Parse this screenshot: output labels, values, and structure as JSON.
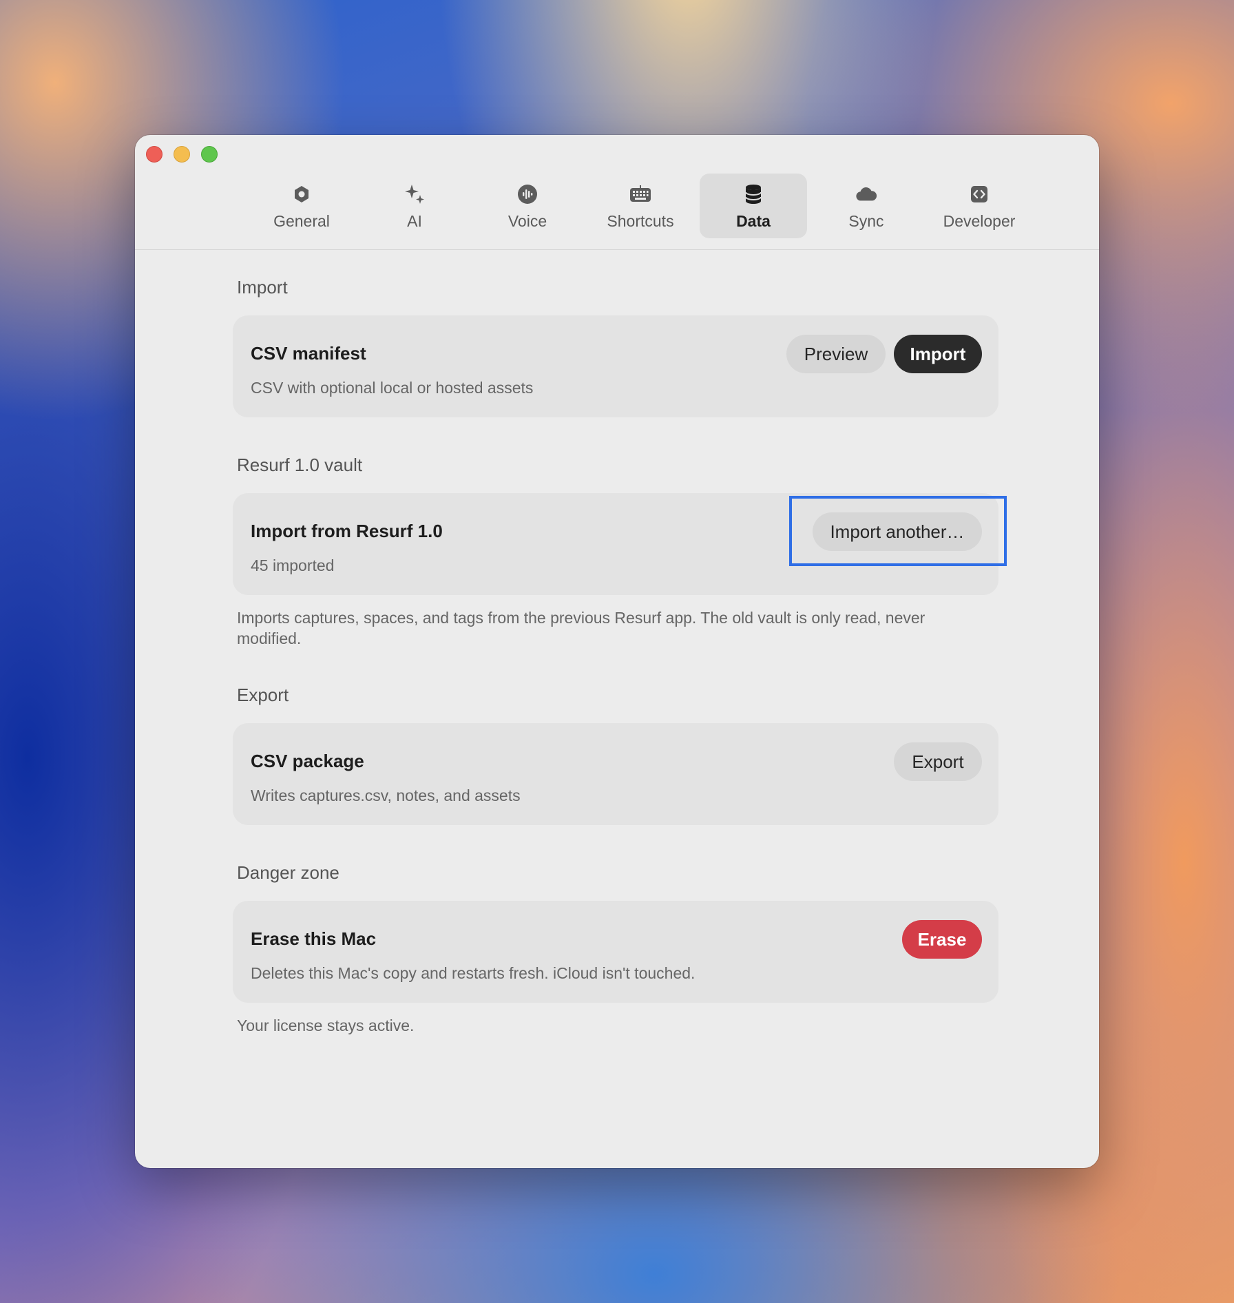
{
  "window": {
    "traffic_lights": [
      "close",
      "minimize",
      "zoom"
    ]
  },
  "tabs": [
    {
      "label": "General",
      "icon": "gear-hexagon-icon"
    },
    {
      "label": "AI",
      "icon": "sparkles-icon"
    },
    {
      "label": "Voice",
      "icon": "waveform-icon"
    },
    {
      "label": "Shortcuts",
      "icon": "keyboard-icon"
    },
    {
      "label": "Data",
      "icon": "database-icon",
      "active": true
    },
    {
      "label": "Sync",
      "icon": "cloud-icon"
    },
    {
      "label": "Developer",
      "icon": "code-icon"
    }
  ],
  "sections": {
    "import": {
      "title": "Import",
      "card_title": "CSV manifest",
      "card_sub": "CSV with optional local or hosted assets",
      "preview_label": "Preview",
      "import_label": "Import"
    },
    "vault": {
      "title": "Resurf 1.0 vault",
      "card_title": "Import from Resurf 1.0",
      "card_sub": "45 imported",
      "button_label": "Import another…",
      "note": "Imports captures, spaces, and tags from the previous Resurf app. The old vault is only read, never modified."
    },
    "export": {
      "title": "Export",
      "card_title": "CSV package",
      "card_sub": "Writes captures.csv, notes, and assets",
      "button_label": "Export"
    },
    "danger": {
      "title": "Danger zone",
      "card_title": "Erase this Mac",
      "card_sub": "Deletes this Mac's copy and restarts fresh. iCloud isn't touched.",
      "button_label": "Erase",
      "note": "Your license stays active."
    }
  },
  "colors": {
    "accent_focus": "#2f6ee6",
    "danger": "#d43d48",
    "primary_button": "#2b2b2b"
  }
}
